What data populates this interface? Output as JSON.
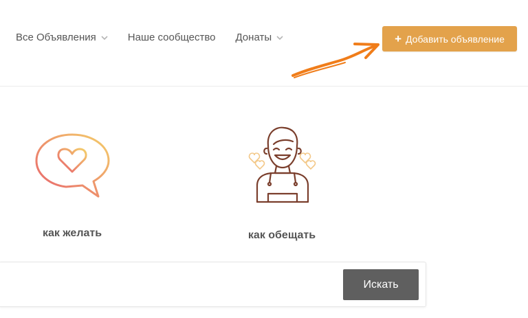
{
  "nav": {
    "items": [
      {
        "label": "Все Объявления",
        "has_dropdown": true
      },
      {
        "label": "Наше сообщество",
        "has_dropdown": false
      },
      {
        "label": "Донаты",
        "has_dropdown": true
      }
    ]
  },
  "header": {
    "add_button": {
      "label": "Добавить объявление",
      "icon": "plus-icon"
    }
  },
  "features": [
    {
      "label": "как желать",
      "icon": "heart-speech-bubble-icon"
    },
    {
      "label": "как обещать",
      "icon": "smiling-person-hearts-icon"
    }
  ],
  "search": {
    "value": "",
    "placeholder": "",
    "button_label": "Искать"
  },
  "colors": {
    "accent": "#e3a24b",
    "annotation_arrow": "#f07d1a",
    "search_button": "#5f5f5f",
    "text": "#555555"
  }
}
